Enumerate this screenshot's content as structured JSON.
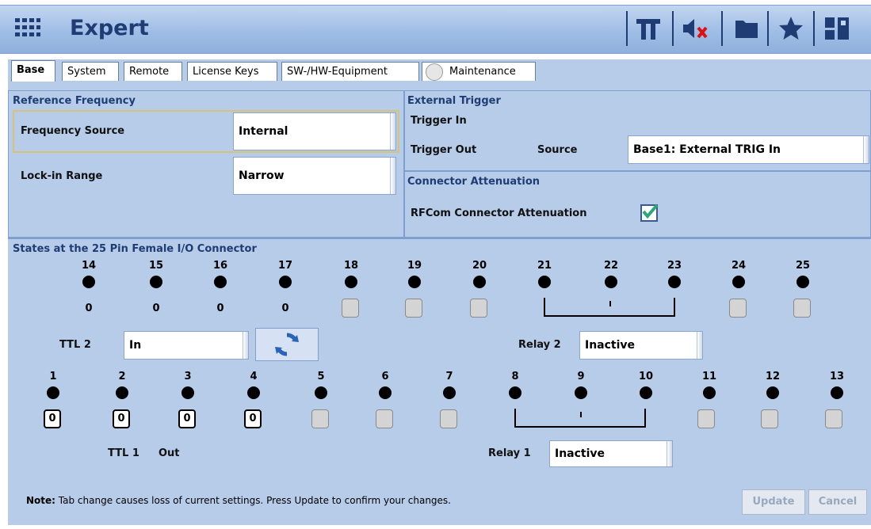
{
  "header": {
    "title": "Expert",
    "icons": [
      "grid-menu-icon",
      "pi-icon",
      "mute-icon",
      "folder-icon",
      "star-icon",
      "layout-icon"
    ]
  },
  "tabs": [
    {
      "label": "Base",
      "active": true
    },
    {
      "label": "System"
    },
    {
      "label": "Remote"
    },
    {
      "label": "License Keys"
    },
    {
      "label": "SW-/HW-Equipment"
    },
    {
      "label": "Maintenance"
    }
  ],
  "reference": {
    "title": "Reference Frequency",
    "freq_source_label": "Frequency Source",
    "freq_source_value": "Internal",
    "lockin_label": "Lock-in Range",
    "lockin_value": "Narrow"
  },
  "trigger": {
    "title": "External Trigger",
    "trigger_in_label": "Trigger In",
    "trigger_out_label": "Trigger Out",
    "source_label": "Source",
    "source_value": "Base1: External TRIG In"
  },
  "attenuation": {
    "title": "Connector Attenuation",
    "rfcom_label": "RFCom Connector Attenuation",
    "rfcom_checked": true
  },
  "connector": {
    "title": "States at the 25 Pin Female I/O Connector",
    "top_pins": [
      "14",
      "15",
      "16",
      "17",
      "18",
      "19",
      "20",
      "21",
      "22",
      "23",
      "24",
      "25"
    ],
    "top_values": [
      "0",
      "0",
      "0",
      "0"
    ],
    "bottom_pins": [
      "1",
      "2",
      "3",
      "4",
      "5",
      "6",
      "7",
      "8",
      "9",
      "10",
      "11",
      "12",
      "13"
    ],
    "bottom_values": [
      "0",
      "0",
      "0",
      "0"
    ],
    "ttl2_label": "TTL 2",
    "ttl2_value": "In",
    "relay2_label": "Relay 2",
    "relay2_value": "Inactive",
    "ttl1_label": "TTL 1",
    "ttl1_value": "Out",
    "relay1_label": "Relay 1",
    "relay1_value": "Inactive"
  },
  "footer": {
    "note_bold": "Note:",
    "note_text": " Tab change causes loss of current settings. Press Update to confirm your changes.",
    "update_label": "Update",
    "cancel_label": "Cancel"
  },
  "colors": {
    "accent": "#1f3c74",
    "panel": "#b7cce9",
    "check": "#2aa876"
  }
}
